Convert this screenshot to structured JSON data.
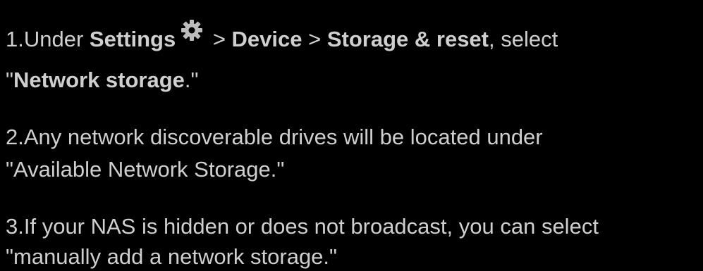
{
  "steps": [
    {
      "number": "1.",
      "text_under": "Under ",
      "settings": "Settings",
      "sep1": " > ",
      "device": "Device",
      "sep2": " > ",
      "storage_reset": "Storage & reset",
      "text_select": ", select",
      "quote_open": "\"",
      "network_storage": "Network storage",
      "quote_close": ".\""
    },
    {
      "number": "2.",
      "line1": "Any network discoverable drives will be located under",
      "line2": "\"Available Network Storage.\""
    },
    {
      "number": "3.",
      "line1": "If your NAS is hidden or does not broadcast, you can select",
      "line2": "\"manually add a network storage.\""
    }
  ],
  "icons": {
    "settings": "gear-icon"
  },
  "colors": {
    "background": "#000000",
    "text": "#cfcfcf",
    "icon": "#bdbdbd"
  }
}
